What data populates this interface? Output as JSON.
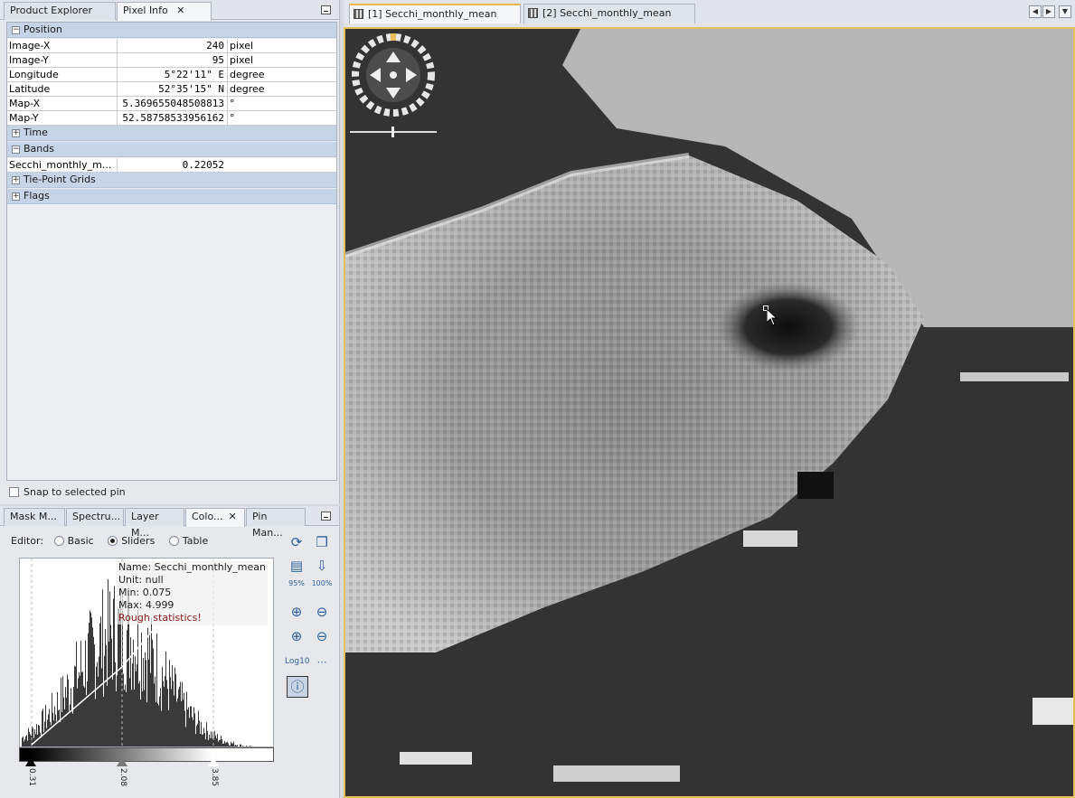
{
  "left_panel": {
    "tabs": [
      {
        "label": "Product Explorer",
        "active": false
      },
      {
        "label": "Pixel Info",
        "active": true
      }
    ],
    "pixel_info": {
      "position": {
        "title": "Position",
        "rows": [
          {
            "name": "Image-X",
            "value": "240",
            "unit": "pixel"
          },
          {
            "name": "Image-Y",
            "value": "95",
            "unit": "pixel"
          },
          {
            "name": "Longitude",
            "value": "5°22'11\" E",
            "unit": "degree"
          },
          {
            "name": "Latitude",
            "value": "52°35'15\" N",
            "unit": "degree"
          },
          {
            "name": "Map-X",
            "value": "5.369655048508813",
            "unit": "°"
          },
          {
            "name": "Map-Y",
            "value": "52.58758533956162",
            "unit": "°"
          }
        ]
      },
      "time": {
        "title": "Time"
      },
      "bands": {
        "title": "Bands",
        "rows": [
          {
            "name": "Secchi_monthly_m...",
            "value": "0.22052",
            "unit": ""
          }
        ]
      },
      "tie_point_grids": {
        "title": "Tie-Point Grids"
      },
      "flags": {
        "title": "Flags"
      }
    },
    "snap_label": "Snap to selected pin"
  },
  "bottom_panel": {
    "tabs": [
      "Mask M...",
      "Spectru...",
      "Layer M...",
      "Colo...",
      "Pin Man..."
    ],
    "editor_label": "Editor:",
    "editor_modes": [
      {
        "label": "Basic",
        "selected": false
      },
      {
        "label": "Sliders",
        "selected": true
      },
      {
        "label": "Table",
        "selected": false
      }
    ],
    "histogram_info": {
      "name": "Name: Secchi_monthly_mean",
      "unit": "Unit: null",
      "min": "Min: 0.075",
      "max": "Max: 4.999",
      "warning": "Rough statistics!"
    },
    "sliders": [
      {
        "label": "0.31",
        "color": "#000000"
      },
      {
        "label": "2.08",
        "color": "#7a7a7a"
      },
      {
        "label": "3.85",
        "color": "#ffffff"
      }
    ],
    "tools": {
      "zoom_95": "95%",
      "zoom_100": "100%",
      "log10": "Log10"
    }
  },
  "viewer": {
    "tabs": [
      {
        "label": "[1] Secchi_monthly_mean",
        "active": true
      },
      {
        "label": "[2] Secchi_monthly_mean",
        "active": false
      }
    ],
    "background_color": "#333333",
    "accent_color": "#e6c056"
  }
}
